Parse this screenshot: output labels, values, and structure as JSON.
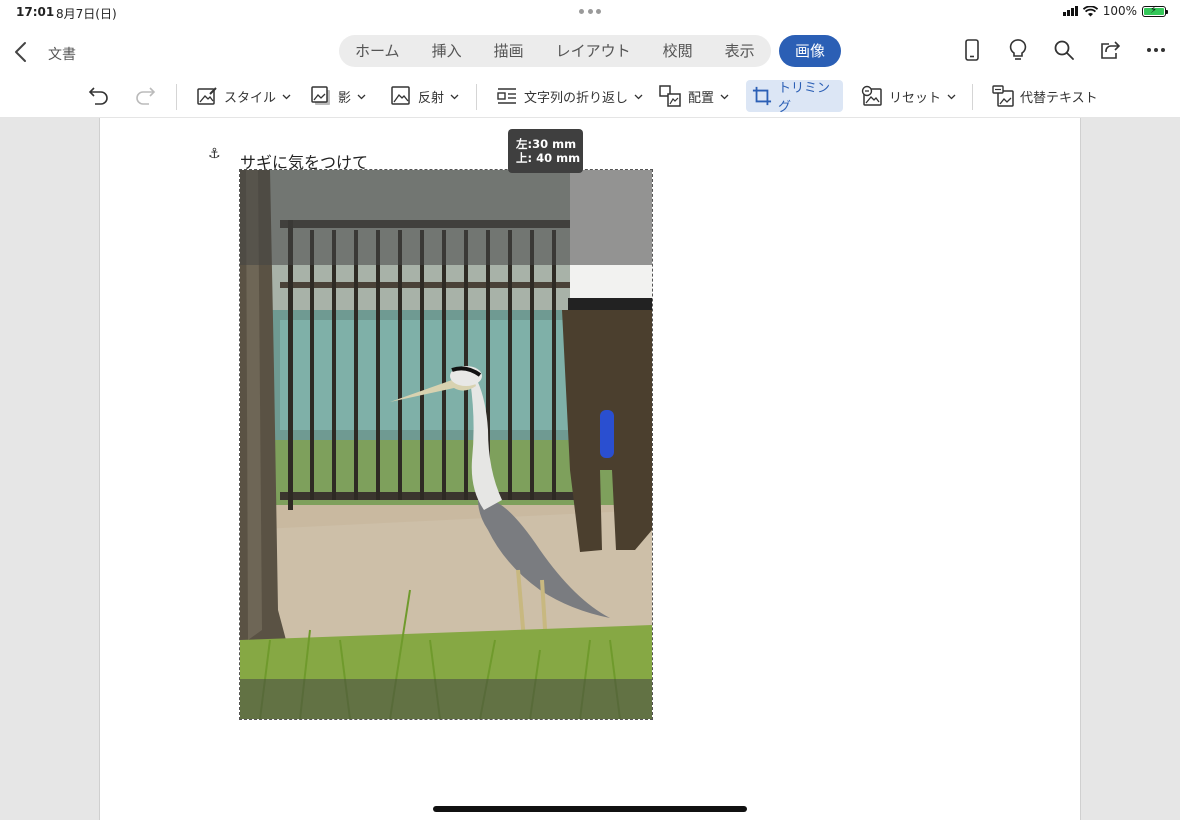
{
  "status": {
    "time": "17:01",
    "date": "8月7日(日)",
    "battery": "100%"
  },
  "header": {
    "back_icon": "chevron-left-icon",
    "doc_title": "文書",
    "tabs": [
      {
        "label": "ホーム"
      },
      {
        "label": "挿入"
      },
      {
        "label": "描画"
      },
      {
        "label": "レイアウト"
      },
      {
        "label": "校閲"
      },
      {
        "label": "表示"
      }
    ],
    "active_tab": "画像",
    "icons": [
      "phone-view-icon",
      "lightbulb-icon",
      "search-icon",
      "share-icon",
      "more-icon"
    ]
  },
  "toolbar": {
    "style": "スタイル",
    "shadow": "影",
    "reflection": "反射",
    "wrap_text": "文字列の折り返し",
    "arrange": "配置",
    "crop": "トリミング",
    "reset": "リセット",
    "alt_text": "代替テキスト"
  },
  "document": {
    "caption": "サギに気をつけて",
    "tooltip_left": "左:30 mm",
    "tooltip_top": "上: 40 mm"
  },
  "colors": {
    "accent": "#2b5fb5",
    "crop_highlight": "#dce6f5"
  }
}
